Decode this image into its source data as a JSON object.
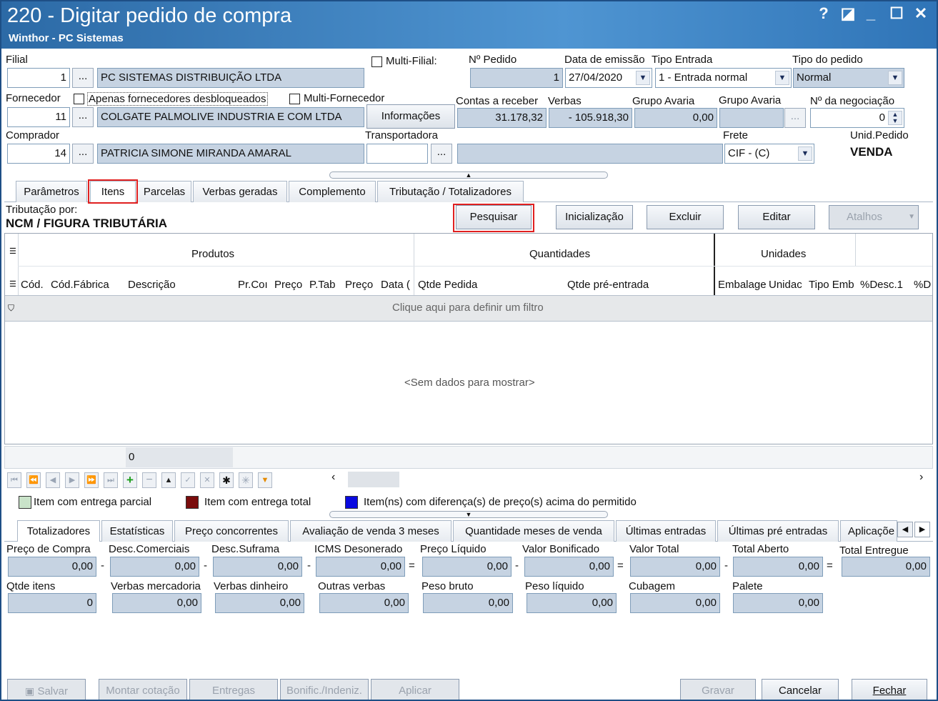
{
  "window": {
    "title": "220 - Digitar pedido de compra",
    "subtitle": "Winthor - PC Sistemas",
    "help": "?",
    "edit": "◪",
    "min": "_",
    "max": "☐",
    "close": "✕"
  },
  "header": {
    "filial": {
      "label": "Filial",
      "code": "1",
      "name": "PC SISTEMAS DISTRIBUIÇÃO LTDA",
      "ellipsis": "..."
    },
    "multi_filial": "Multi-Filial:",
    "pedido": {
      "label": "Nº Pedido",
      "value": "1"
    },
    "data_emissao": {
      "label": "Data de emissão",
      "value": "27/04/2020"
    },
    "tipo_entrada": {
      "label": "Tipo Entrada",
      "value": "1 - Entrada normal"
    },
    "tipo_pedido": {
      "label": "Tipo do pedido",
      "value": "Normal"
    },
    "fornecedor": {
      "label": "Fornecedor",
      "code": "11",
      "name": "COLGATE PALMOLIVE INDUSTRIA  E COM LTDA",
      "ellipsis": "..."
    },
    "apenas_desbloqueados": "Apenas fornecedores desbloqueados",
    "multi_fornecedor": "Multi-Fornecedor",
    "informacoes": "Informações",
    "contas_receber": {
      "label": "Contas a receber",
      "value": "31.178,32"
    },
    "verbas": {
      "label": "Verbas",
      "value": "- 105.918,30"
    },
    "grupo_avaria_1": {
      "label": "Grupo Avaria",
      "value": "0,00"
    },
    "grupo_avaria_2": {
      "label": "Grupo Avaria",
      "value": "",
      "ellipsis": "..."
    },
    "negociacao": {
      "label": "Nº da negociação",
      "value": "0"
    },
    "comprador": {
      "label": "Comprador",
      "code": "14",
      "name": "PATRICIA SIMONE MIRANDA AMARAL",
      "ellipsis": "..."
    },
    "transportadora": {
      "label": "Transportadora",
      "code": "",
      "ellipsis": "..."
    },
    "frete": {
      "label": "Frete",
      "value": "CIF - (C)"
    },
    "unid_pedido": {
      "label": "Unid.Pedido",
      "value": "VENDA"
    }
  },
  "tabs": [
    "Parâmetros",
    "Itens",
    "Parcelas",
    "Verbas geradas",
    "Complemento",
    "Tributação / Totalizadores"
  ],
  "itens": {
    "tributacao_label": "Tributação por:",
    "tributacao_value": "NCM / FIGURA TRIBUTÁRIA",
    "buttons": {
      "pesquisar": "Pesquisar",
      "inicializacao": "Inicialização",
      "excluir": "Excluir",
      "editar": "Editar",
      "atalhos": "Atalhos"
    },
    "band_headers": [
      "Produtos",
      "Quantidades",
      "Unidades"
    ],
    "columns": [
      "Cód.",
      "Cód.Fábrica",
      "Descrição",
      "Pr.Coı",
      "Preço",
      "P.Tab",
      "Preço",
      "Data (",
      "Qtde Pedida",
      "Qtde pré-entrada",
      "Embalage",
      "Unidac",
      "Tipo Emb",
      "%Desc.1",
      "%D"
    ],
    "filter_row": "Clique aqui para definir um filtro",
    "empty": "<Sem dados para mostrar>",
    "footer_sum": "0"
  },
  "legend": [
    {
      "label": "Item com entrega parcial",
      "color": "#c9e3c9"
    },
    {
      "label": "Item com entrega total",
      "color": "#7a0c0c"
    },
    {
      "label": "Item(ns) com diferença(s) de preço(s) acima do permitido",
      "color": "#0a0ae0"
    }
  ],
  "bottom_tabs": [
    "Totalizadores",
    "Estatísticas",
    "Preço concorrentes",
    "Avaliação de venda 3 meses",
    "Quantidade meses de venda",
    "Últimas entradas",
    "Últimas pré entradas",
    "Aplicaçõe"
  ],
  "totals_row1": [
    {
      "label": "Preço de Compra",
      "value": "0,00",
      "op": "-"
    },
    {
      "label": "Desc.Comerciais",
      "value": "0,00",
      "op": "-"
    },
    {
      "label": "Desc.Suframa",
      "value": "0,00",
      "op": "-"
    },
    {
      "label": "ICMS Desonerado",
      "value": "0,00",
      "op": "="
    },
    {
      "label": "Preço Líquido",
      "value": "0,00",
      "op": "-"
    },
    {
      "label": "Valor Bonificado",
      "value": "0,00",
      "op": "="
    },
    {
      "label": "Valor Total",
      "value": "0,00",
      "op": "-"
    },
    {
      "label": "Total Aberto",
      "value": "0,00",
      "op": "="
    },
    {
      "label": "Total Entregue",
      "value": "0,00",
      "op": ""
    }
  ],
  "totals_row2": [
    {
      "label": "Qtde itens",
      "value": "0"
    },
    {
      "label": "Verbas mercadoria",
      "value": "0,00"
    },
    {
      "label": "Verbas dinheiro",
      "value": "0,00"
    },
    {
      "label": "Outras verbas",
      "value": "0,00"
    },
    {
      "label": "Peso bruto",
      "value": "0,00"
    },
    {
      "label": "Peso líquido",
      "value": "0,00"
    },
    {
      "label": "Cubagem",
      "value": "0,00"
    },
    {
      "label": "Palete",
      "value": "0,00"
    }
  ],
  "actions": {
    "salvar": "Salvar",
    "montar_cotacao": "Montar cotação",
    "entregas": "Entregas",
    "bonific": "Bonific./Indeniz.",
    "aplicar": "Aplicar",
    "gravar": "Gravar",
    "cancelar": "Cancelar",
    "fechar": "Fechar"
  }
}
